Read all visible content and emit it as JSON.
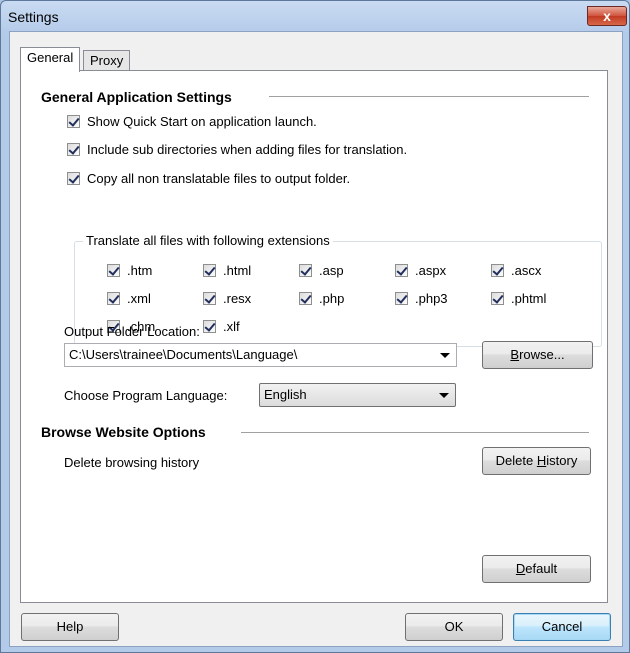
{
  "window": {
    "title": "Settings",
    "close_glyph": "x"
  },
  "tabs": [
    {
      "label": "General",
      "active": true
    },
    {
      "label": "Proxy",
      "active": false
    }
  ],
  "general_section": {
    "title": "General Application Settings",
    "options": [
      {
        "label": "Show Quick Start on application launch.",
        "checked": true
      },
      {
        "label": "Include sub directories when adding files for translation.",
        "checked": true
      },
      {
        "label": "Copy all non translatable files to output folder.",
        "checked": true
      }
    ],
    "extensions_group": {
      "label": "Translate all files with following extensions",
      "items": [
        {
          "label": ".htm",
          "checked": true
        },
        {
          "label": ".html",
          "checked": true
        },
        {
          "label": ".asp",
          "checked": true
        },
        {
          "label": ".aspx",
          "checked": true
        },
        {
          "label": ".ascx",
          "checked": true
        },
        {
          "label": ".xml",
          "checked": true
        },
        {
          "label": ".resx",
          "checked": true
        },
        {
          "label": ".php",
          "checked": true
        },
        {
          "label": ".php3",
          "checked": true
        },
        {
          "label": ".phtml",
          "checked": true
        },
        {
          "label": ".chm",
          "checked": true
        },
        {
          "label": ".xlf",
          "checked": true
        }
      ]
    },
    "output_folder": {
      "label": "Output Folder Location:",
      "value": "C:\\Users\\trainee\\Documents\\Language\\",
      "browse_first": "B",
      "browse_rest": "rowse..."
    },
    "language": {
      "label": "Choose Program Language:",
      "value": "English"
    }
  },
  "browse_section": {
    "title": "Browse Website Options",
    "delete_label": "Delete browsing history",
    "delete_btn_first": "Delete ",
    "delete_btn_key": "H",
    "delete_btn_rest": "istory"
  },
  "panel_buttons": {
    "default_key": "D",
    "default_rest": "efault"
  },
  "footer": {
    "help": "Help",
    "ok": "OK",
    "cancel": "Cancel"
  },
  "colors": {
    "accent": "#3c7fb1",
    "close": "#c13a23"
  }
}
